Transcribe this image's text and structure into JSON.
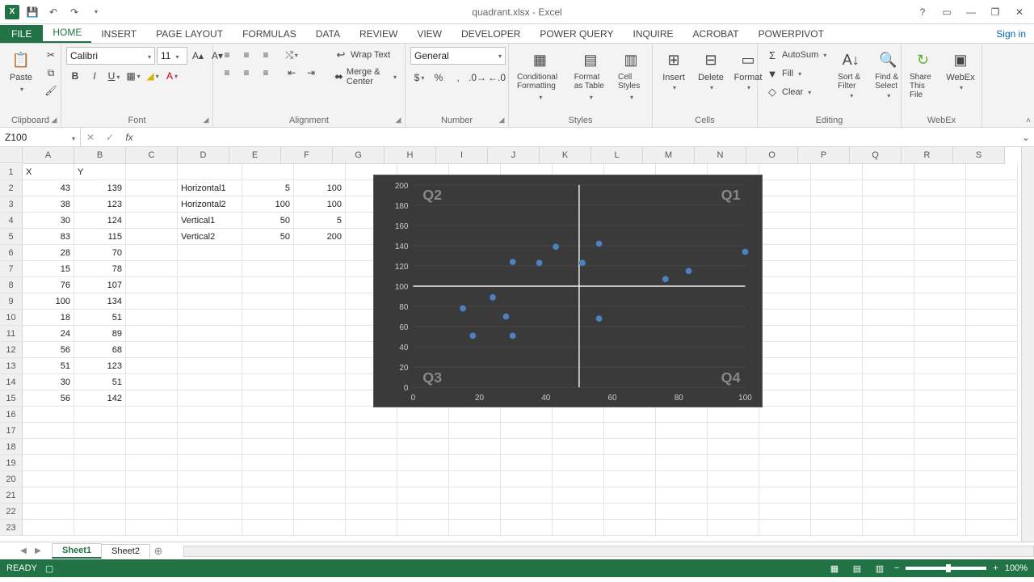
{
  "title": "quadrant.xlsx - Excel",
  "signin": "Sign in",
  "tabs": [
    "HOME",
    "INSERT",
    "PAGE LAYOUT",
    "FORMULAS",
    "DATA",
    "REVIEW",
    "VIEW",
    "DEVELOPER",
    "POWER QUERY",
    "INQUIRE",
    "ACROBAT",
    "POWERPIVOT"
  ],
  "ribbon": {
    "clipboard": {
      "paste": "Paste",
      "label": "Clipboard"
    },
    "font": {
      "name": "Calibri",
      "size": "11",
      "label": "Font"
    },
    "alignment": {
      "wrap": "Wrap Text",
      "merge": "Merge & Center",
      "label": "Alignment"
    },
    "number": {
      "format": "General",
      "label": "Number"
    },
    "styles": {
      "cond": "Conditional Formatting",
      "fat": "Format as Table",
      "cell": "Cell Styles",
      "label": "Styles"
    },
    "cells": {
      "ins": "Insert",
      "del": "Delete",
      "fmt": "Format",
      "label": "Cells"
    },
    "editing": {
      "sum": "AutoSum",
      "fill": "Fill",
      "clear": "Clear",
      "sort": "Sort & Filter",
      "find": "Find & Select",
      "label": "Editing"
    },
    "webex": {
      "share": "Share This File",
      "wx": "WebEx",
      "label": "WebEx"
    }
  },
  "namebox": "Z100",
  "columns": [
    "A",
    "B",
    "C",
    "D",
    "E",
    "F",
    "G",
    "H",
    "I",
    "J",
    "K",
    "L",
    "M",
    "N",
    "O",
    "P",
    "Q",
    "R",
    "S"
  ],
  "rows_header": [
    "1",
    "2",
    "3",
    "4",
    "5",
    "6",
    "7",
    "8",
    "9",
    "10",
    "11",
    "12",
    "13",
    "14",
    "15",
    "16",
    "17",
    "18",
    "19",
    "20",
    "21",
    "22",
    "23"
  ],
  "sheet_data": {
    "header": {
      "A": "X",
      "B": "Y"
    },
    "xy": [
      [
        43,
        139
      ],
      [
        38,
        123
      ],
      [
        30,
        124
      ],
      [
        83,
        115
      ],
      [
        28,
        70
      ],
      [
        15,
        78
      ],
      [
        76,
        107
      ],
      [
        100,
        134
      ],
      [
        18,
        51
      ],
      [
        24,
        89
      ],
      [
        56,
        68
      ],
      [
        51,
        123
      ],
      [
        30,
        51
      ],
      [
        56,
        142
      ]
    ],
    "lines": [
      [
        "Horizontal1",
        5,
        100
      ],
      [
        "Horizontal2",
        100,
        100
      ],
      [
        "Vertical1",
        50,
        5
      ],
      [
        "Vertical2",
        50,
        200
      ]
    ]
  },
  "sheets": [
    "Sheet1",
    "Sheet2"
  ],
  "status": {
    "ready": "READY",
    "zoom": "100%"
  },
  "chart_data": {
    "type": "scatter",
    "x": [
      43,
      38,
      30,
      83,
      28,
      70,
      15,
      78,
      76,
      107,
      100,
      134,
      18,
      51,
      24,
      89,
      56,
      68,
      51,
      123,
      30,
      51,
      56,
      142
    ],
    "points": [
      {
        "x": 43,
        "y": 139
      },
      {
        "x": 38,
        "y": 123
      },
      {
        "x": 30,
        "y": 124
      },
      {
        "x": 83,
        "y": 115
      },
      {
        "x": 28,
        "y": 70
      },
      {
        "x": 15,
        "y": 78
      },
      {
        "x": 76,
        "y": 107
      },
      {
        "x": 100,
        "y": 134
      },
      {
        "x": 18,
        "y": 51
      },
      {
        "x": 24,
        "y": 89
      },
      {
        "x": 56,
        "y": 68
      },
      {
        "x": 51,
        "y": 123
      },
      {
        "x": 30,
        "y": 51
      },
      {
        "x": 56,
        "y": 142
      }
    ],
    "xlim": [
      0,
      100
    ],
    "ylim": [
      0,
      200
    ],
    "xticks": [
      0,
      20,
      40,
      60,
      80,
      100
    ],
    "yticks": [
      0,
      20,
      40,
      60,
      80,
      100,
      120,
      140,
      160,
      180,
      200
    ],
    "vline": 50,
    "hline": 100,
    "quadrant_labels": {
      "Q1": "Q1",
      "Q2": "Q2",
      "Q3": "Q3",
      "Q4": "Q4"
    }
  }
}
